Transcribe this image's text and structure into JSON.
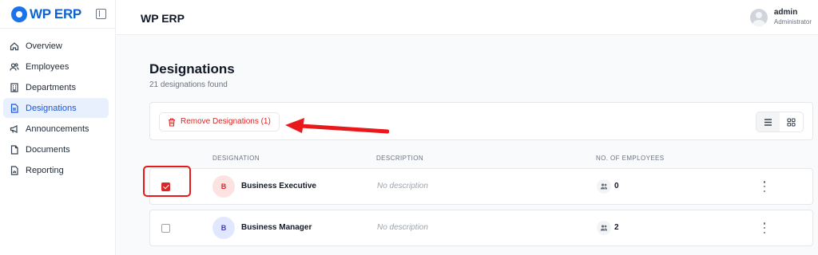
{
  "brand": {
    "name": "WP ERP"
  },
  "sidebar": {
    "items": [
      {
        "label": "Overview",
        "icon": "home-icon"
      },
      {
        "label": "Employees",
        "icon": "users-icon"
      },
      {
        "label": "Departments",
        "icon": "building-icon"
      },
      {
        "label": "Designations",
        "icon": "document-icon",
        "active": true
      },
      {
        "label": "Announcements",
        "icon": "megaphone-icon"
      },
      {
        "label": "Documents",
        "icon": "file-icon"
      },
      {
        "label": "Reporting",
        "icon": "report-icon"
      }
    ]
  },
  "header": {
    "title": "WP ERP",
    "user": {
      "name": "admin",
      "role": "Administrator"
    }
  },
  "main": {
    "title": "Designations",
    "subtitle": "21 designations found",
    "toolbar": {
      "remove_label": "Remove Designations (1)",
      "view_modes": [
        "list-view-icon",
        "grid-view-icon"
      ],
      "active_view": "list"
    },
    "columns": [
      "DESIGNATION",
      "DESCRIPTION",
      "NO. OF EMPLOYEES"
    ],
    "rows": [
      {
        "checked": true,
        "initial": "B",
        "name": "Business Executive",
        "description": "No description",
        "employees": "0"
      },
      {
        "checked": false,
        "initial": "B",
        "name": "Business Manager",
        "description": "No description",
        "employees": "2"
      }
    ]
  },
  "colors": {
    "brand": "#0e63d3",
    "active_nav_bg": "#e8f0fe",
    "danger": "#dc2626",
    "annotation": "#e8181b"
  }
}
